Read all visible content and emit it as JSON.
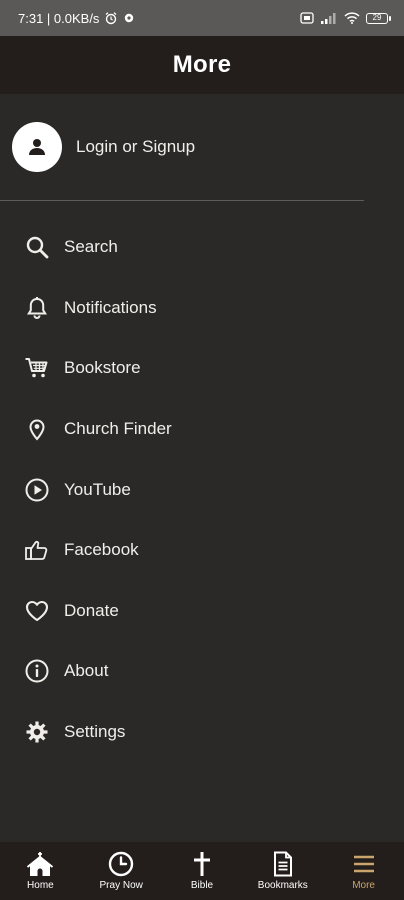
{
  "status_bar": {
    "time_network": "7:31 | 0.0KB/s",
    "battery": "29"
  },
  "header": {
    "title": "More"
  },
  "account": {
    "login_label": "Login or Signup"
  },
  "menu": [
    {
      "label": "Search",
      "icon": "search-icon"
    },
    {
      "label": "Notifications",
      "icon": "bell-icon"
    },
    {
      "label": "Bookstore",
      "icon": "cart-icon"
    },
    {
      "label": "Church Finder",
      "icon": "location-pin-icon"
    },
    {
      "label": "YouTube",
      "icon": "play-circle-icon"
    },
    {
      "label": "Facebook",
      "icon": "thumbs-up-icon"
    },
    {
      "label": "Donate",
      "icon": "heart-icon"
    },
    {
      "label": "About",
      "icon": "info-icon"
    },
    {
      "label": "Settings",
      "icon": "gear-icon"
    }
  ],
  "bottom_nav": {
    "items": [
      {
        "label": "Home",
        "icon": "church-icon"
      },
      {
        "label": "Pray Now",
        "icon": "clock-icon"
      },
      {
        "label": "Bible",
        "icon": "cross-icon"
      },
      {
        "label": "Bookmarks",
        "icon": "document-icon"
      },
      {
        "label": "More",
        "icon": "hamburger-icon",
        "active": true
      }
    ]
  },
  "colors": {
    "background": "#2b2928",
    "header": "#231d1b",
    "active_accent": "#c9a56d",
    "status_bar": "#5b5958"
  }
}
